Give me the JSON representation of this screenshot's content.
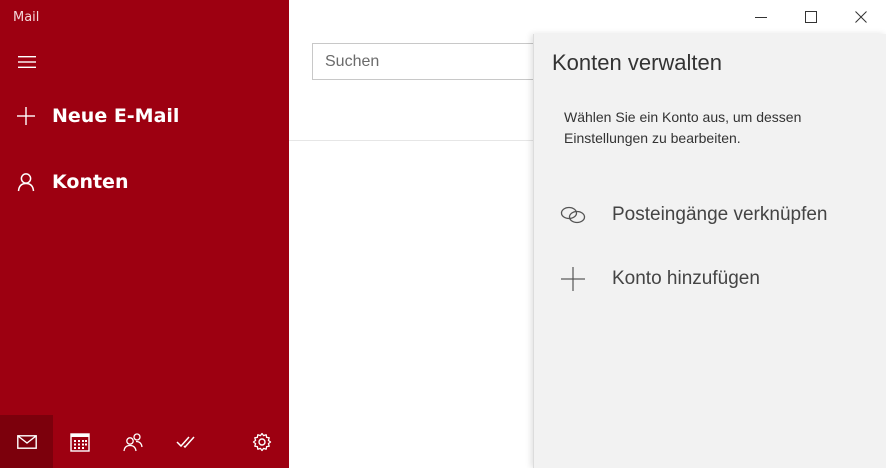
{
  "app": {
    "title": "Mail"
  },
  "sidebar": {
    "new_mail_label": "Neue E-Mail",
    "accounts_label": "Konten"
  },
  "search": {
    "placeholder": "Suchen"
  },
  "panel": {
    "title": "Konten verwalten",
    "description": "Wählen Sie ein Konto aus, um dessen Einstellungen zu bearbeiten.",
    "items": [
      {
        "label": "Posteingänge verknüpfen",
        "icon": "link-icon"
      },
      {
        "label": "Konto hinzufügen",
        "icon": "plus-icon"
      }
    ]
  },
  "bottom_bar": {
    "items": [
      "mail-icon",
      "calendar-icon",
      "people-icon",
      "todo-icon",
      "settings-icon"
    ],
    "active": "mail-icon"
  },
  "colors": {
    "accent": "#9d0011",
    "accent_dark": "#7c000c",
    "panel_bg": "#f2f2f2"
  }
}
